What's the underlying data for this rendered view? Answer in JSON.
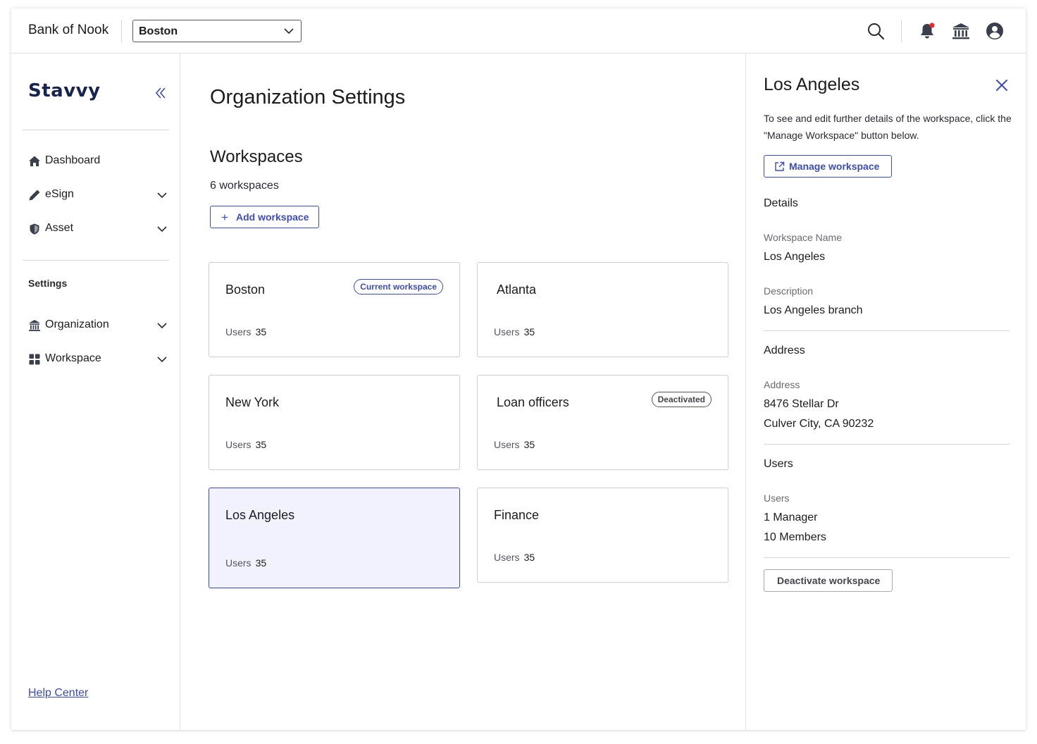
{
  "topbar": {
    "org_name": "Bank of Nook",
    "workspace_selector": {
      "value": "Boston"
    },
    "icons": [
      "search-icon",
      "bell-icon",
      "bank-icon",
      "user-icon"
    ],
    "notification_dot_color": "#e02d2d"
  },
  "sidebar": {
    "logo": "Stavvy",
    "nav": [
      {
        "label": "Dashboard",
        "icon": "home-icon",
        "expandable": false
      },
      {
        "label": "eSign",
        "icon": "pen-icon",
        "expandable": true
      },
      {
        "label": "Asset",
        "icon": "shield-icon",
        "expandable": true
      }
    ],
    "settings_label": "Settings",
    "settings_nav": [
      {
        "label": "Organization",
        "icon": "bank-icon",
        "expandable": true
      },
      {
        "label": "Workspace",
        "icon": "grid-icon",
        "expandable": true
      }
    ],
    "help_center": "Help Center"
  },
  "main": {
    "page_title": "Organization Settings",
    "section_title": "Workspaces",
    "workspace_count": "6 workspaces",
    "add_button": "Add workspace",
    "users_label": "Users",
    "cards": [
      {
        "title": "Boston",
        "users": "35",
        "badge": "Current workspace"
      },
      {
        "title": "Atlanta",
        "users": "35",
        "badge": ""
      },
      {
        "title": "New York",
        "users": "35",
        "badge": ""
      },
      {
        "title": "Loan officers",
        "users": "35",
        "badge": "Deactivated"
      },
      {
        "title": "Los Angeles",
        "users": "35",
        "badge": "",
        "selected": true
      },
      {
        "title": "Finance",
        "users": "35",
        "badge": ""
      }
    ]
  },
  "panel": {
    "title": "Los Angeles",
    "description": "To see and edit further details of the workspace, click the \"Manage Workspace\" button below.",
    "manage_button": "Manage workspace",
    "details_heading": "Details",
    "workspace_name_label": "Workspace Name",
    "workspace_name_value": "Los Angeles",
    "description_label": "Description",
    "description_value": "Los Angeles branch",
    "address_heading": "Address",
    "address_label": "Address",
    "address_line1": "8476 Stellar Dr",
    "address_line2": "Culver City, CA 90232",
    "users_heading": "Users",
    "users_label": "Users",
    "users_manager": "1 Manager",
    "users_members": "10 Members",
    "deactivate_button": "Deactivate workspace"
  },
  "colors": {
    "accent": "#3b4bc4",
    "logo": "#17244f",
    "selected_card_bg": "#f1f2fd"
  }
}
